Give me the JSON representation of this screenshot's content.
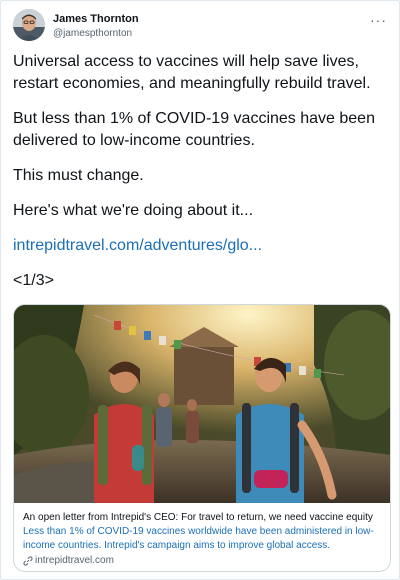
{
  "author": {
    "name": "James Thornton",
    "handle": "@jamespthornton"
  },
  "tweet": {
    "paragraph1": "Universal access to vaccines will help save lives, restart economies, and meaningfully rebuild travel.",
    "paragraph2": "But less than 1% of COVID-19 vaccines have been delivered to low-income countries.",
    "paragraph3": "This must change.",
    "paragraph4": "Here's what we're doing about it...",
    "link": "intrepidtravel.com/adventures/glo...",
    "thread_counter": "<1/3>"
  },
  "card": {
    "title": "An open letter from Intrepid's CEO: For travel to return, we need vaccine equity",
    "description": "Less than 1% of COVID-19 vaccines worldwide have been administered in low-income countries. Intrepid's campaign aims to improve global access.",
    "domain": "intrepidtravel.com"
  },
  "icons": {
    "more": "more-options-icon",
    "link": "link-icon"
  },
  "colors": {
    "link": "#1b6fb8",
    "secondary_text": "#536471",
    "border": "#cfd9de"
  }
}
